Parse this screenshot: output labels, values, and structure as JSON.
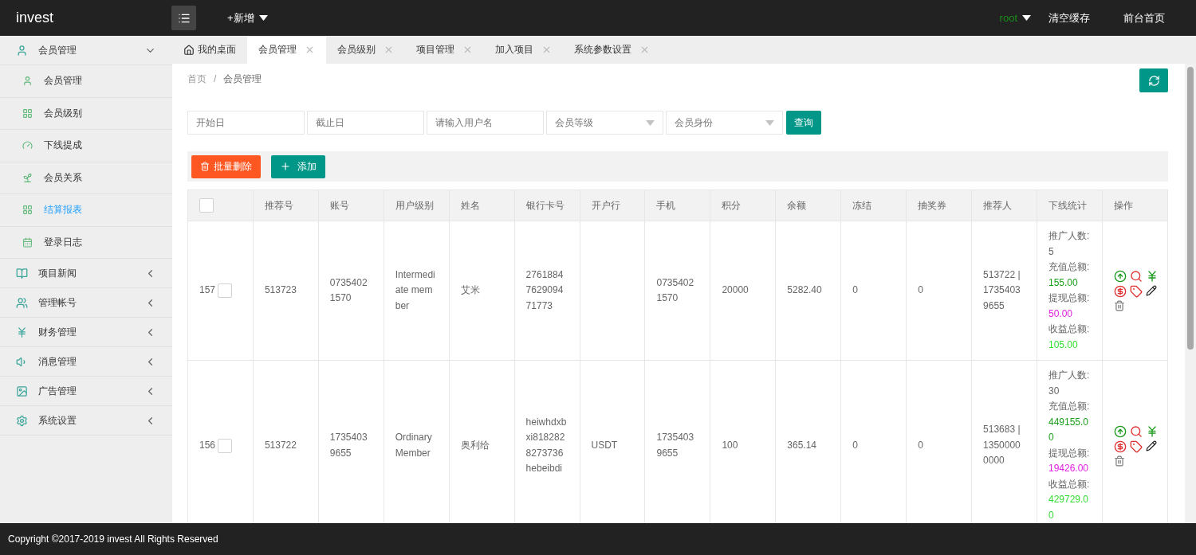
{
  "header": {
    "logo": "invest",
    "new_menu": "+新增",
    "user": "root",
    "links": [
      "清空缓存",
      "前台首页"
    ]
  },
  "sidebar": {
    "groups": [
      {
        "label": "会员管理",
        "expanded": true,
        "children": [
          {
            "label": "会员管理",
            "selected": false
          },
          {
            "label": "会员级别",
            "selected": false
          },
          {
            "label": "下线提成",
            "selected": false
          },
          {
            "label": "会员关系",
            "selected": false
          },
          {
            "label": "结算报表",
            "selected": true
          },
          {
            "label": "登录日志",
            "selected": false
          }
        ]
      },
      {
        "label": "项目新闻",
        "expanded": false
      },
      {
        "label": "管理帐号",
        "expanded": false
      },
      {
        "label": "财务管理",
        "expanded": false
      },
      {
        "label": "消息管理",
        "expanded": false
      },
      {
        "label": "广告管理",
        "expanded": false
      },
      {
        "label": "系统设置",
        "expanded": false
      }
    ]
  },
  "tabs": [
    {
      "label": "我的桌面",
      "kind": "home",
      "selected": false
    },
    {
      "label": "会员管理",
      "kind": "page",
      "selected": true
    },
    {
      "label": "会员级别",
      "kind": "page",
      "selected": false
    },
    {
      "label": "项目管理",
      "kind": "page",
      "selected": false
    },
    {
      "label": "加入项目",
      "kind": "page",
      "selected": false
    },
    {
      "label": "系统参数设置",
      "kind": "page",
      "selected": false
    }
  ],
  "breadcrumb": [
    "首页",
    "会员管理"
  ],
  "breadcrumb_separator": "/",
  "filters": [
    {
      "kind": "input",
      "placeholder": "开始日"
    },
    {
      "kind": "input",
      "placeholder": "截止日"
    },
    {
      "kind": "input",
      "placeholder": "请输入用户名"
    },
    {
      "kind": "select",
      "placeholder": "会员等级"
    },
    {
      "kind": "select",
      "placeholder": "会员身份"
    }
  ],
  "search_button": "查询",
  "toolbar": {
    "delete_button": "批量删除",
    "add_button": "添加"
  },
  "table": {
    "header_checked": false,
    "columns": [
      "推荐号",
      "账号",
      "用户级别",
      "姓名",
      "银行卡号",
      "开户行",
      "手机",
      "积分",
      "余额",
      "冻结",
      "抽奖券",
      "推荐人",
      "下线统计",
      "操作"
    ],
    "rows": [
      {
        "id": "157",
        "checked": false,
        "cells": [
          "513723",
          "07354021570",
          "Intermediate member",
          "艾米",
          "2761884762909471773",
          "",
          "07354021570",
          "20000",
          "5282.40",
          "0",
          "0",
          "513722 | 17354039655"
        ],
        "stats": [
          {
            "label": "推广人数:",
            "value": "5",
            "kind": "count"
          },
          {
            "label": "充值总额:",
            "value": "155.00",
            "kind": "recharge"
          },
          {
            "label": "提现总额:",
            "value": "50.00",
            "kind": "withdraw"
          },
          {
            "label": "收益总额:",
            "value": "105.00",
            "kind": "income"
          }
        ]
      },
      {
        "id": "156",
        "checked": false,
        "cells": [
          "513722",
          "17354039655",
          "Ordinary Member",
          "奥利给",
          "heiwhdxbxi8182828273736hebeibdi",
          "USDT",
          "17354039655",
          "100",
          "365.14",
          "0",
          "0",
          "513683 | 13500000000"
        ],
        "stats": [
          {
            "label": "推广人数:",
            "value": "30",
            "kind": "count"
          },
          {
            "label": "充值总额:",
            "value": "449155.00",
            "kind": "recharge"
          },
          {
            "label": "提现总额:",
            "value": "19426.00",
            "kind": "withdraw"
          },
          {
            "label": "收益总额:",
            "value": "429729.00",
            "kind": "income"
          }
        ]
      }
    ]
  },
  "footer": "Copyright ©2017-2019 invest All Rights Reserved"
}
